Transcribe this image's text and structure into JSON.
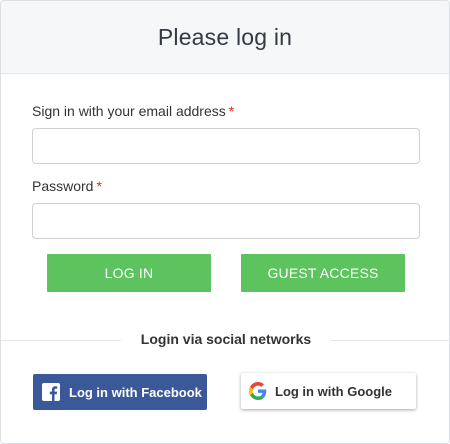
{
  "header": {
    "title": "Please log in"
  },
  "form": {
    "email": {
      "label": "Sign in with your email address",
      "required_mark": "*",
      "value": "",
      "placeholder": ""
    },
    "password": {
      "label": "Password",
      "required_mark": "*",
      "value": "",
      "placeholder": ""
    },
    "login_label": "LOG IN",
    "guest_label": "GUEST ACCESS"
  },
  "social": {
    "heading": "Login via social networks",
    "facebook_label": "Log in with Facebook",
    "google_label": "Log in with Google"
  },
  "colors": {
    "accent_green": "#5cc35e",
    "facebook_blue": "#3b5998",
    "required_red": "#e02424"
  },
  "icons": {
    "facebook": "facebook-icon",
    "google": "google-icon"
  }
}
